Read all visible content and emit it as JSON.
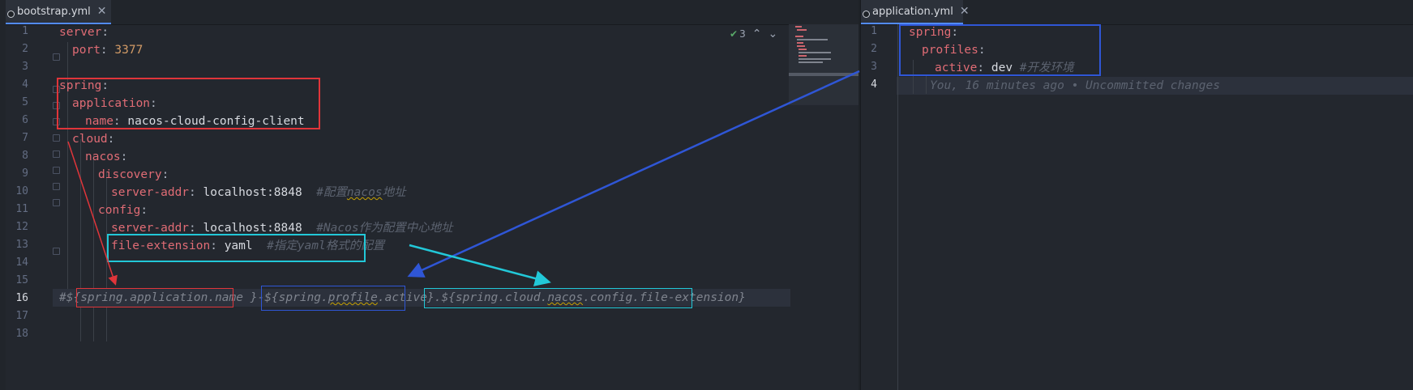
{
  "left_tab": {
    "label": "bootstrap.yml",
    "close": "✕"
  },
  "right_tab": {
    "label": "application.yml",
    "close": "✕"
  },
  "inspection": {
    "count": "3",
    "check": "✔",
    "up": "⌃",
    "down": "⌄"
  },
  "left_lines": [
    "1",
    "2",
    "3",
    "4",
    "5",
    "6",
    "7",
    "8",
    "9",
    "10",
    "11",
    "12",
    "13",
    "14",
    "15",
    "16",
    "17",
    "18"
  ],
  "code": {
    "l1_key": "server",
    "colon": ":",
    "l2_key": "port",
    "l2_val": "3377",
    "l4_key": "spring",
    "l5_key": "application",
    "l6_key": "name",
    "l6_val": "nacos-cloud-config-client",
    "l7_key": "cloud",
    "l8_key": "nacos",
    "l9_key": "discovery",
    "l10_key": "server-addr",
    "l10_val": "localhost:8848",
    "l10_comment_a": "#配置",
    "l10_comment_b": "nacos",
    "l10_comment_c": "地址",
    "l11_key": "config",
    "l12_key": "server-addr",
    "l12_val": "localhost:8848",
    "l12_comment": "#Nacos作为配置中心地址",
    "l13_key": "file-extension",
    "l13_val": "yaml",
    "l13_comment": "#指定yaml格式的配置",
    "l16_a": "#${",
    "l16_b": "spring.application.name",
    "l16_c": " }-${",
    "l16_d1": "spring.",
    "l16_d2": "profile",
    "l16_d3": ".active",
    "l16_e": "}.${",
    "l16_f1": "spring.cloud.",
    "l16_f2": "nacos",
    "l16_f3": ".config.file-extension",
    "l16_g": "}"
  },
  "right_lines": [
    "1",
    "2",
    "3",
    "4"
  ],
  "right_code": {
    "r1_key": "spring",
    "r2_key": "profiles",
    "r3_key": "active",
    "r3_val": "dev",
    "r3_comment": "#开发环境",
    "blame": "You, 16 minutes ago • Uncommitted changes"
  },
  "annotation_colors": {
    "red": "#e0353a",
    "blue": "#2f56d6",
    "cyan": "#22c8d8"
  }
}
